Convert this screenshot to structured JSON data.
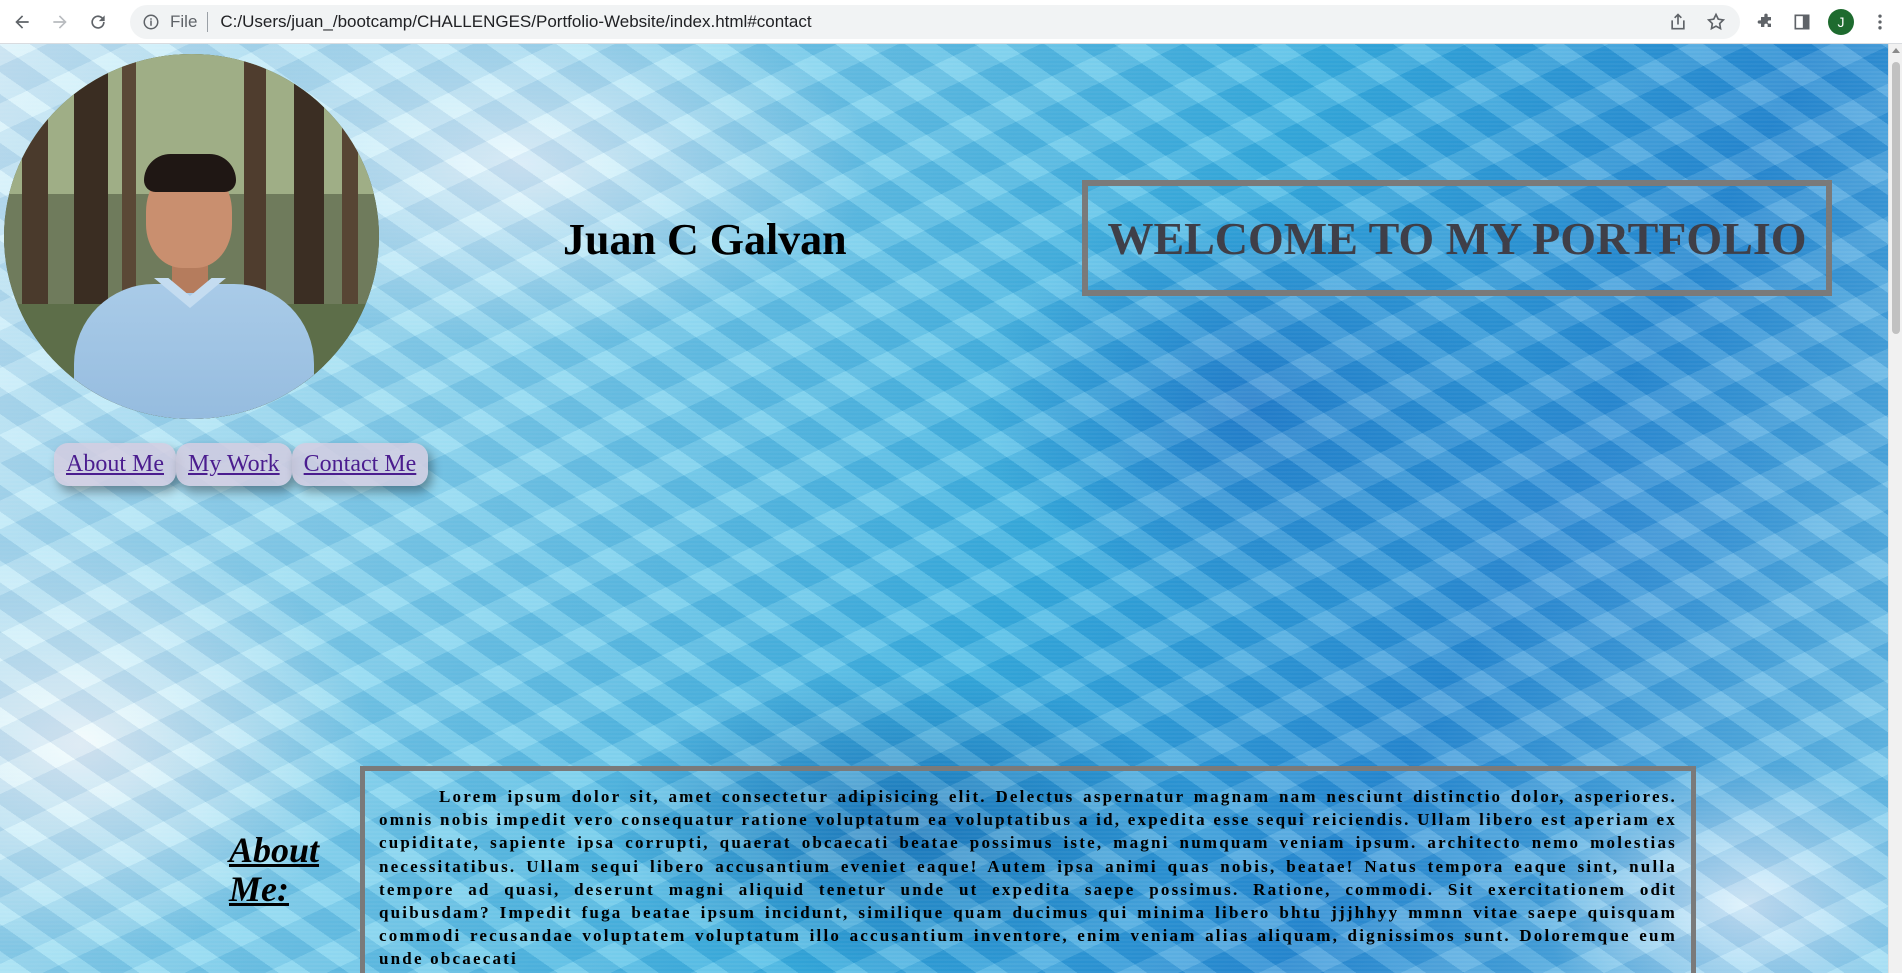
{
  "browser": {
    "scheme_label": "File",
    "url": "C:/Users/juan_/bootcamp/CHALLENGES/Portfolio-Website/index.html#contact",
    "profile_initial": "J"
  },
  "page": {
    "name": "Juan C Galvan",
    "welcome": "WELCOME TO MY PORTFOLIO",
    "nav": [
      {
        "label": "About Me"
      },
      {
        "label": "My Work"
      },
      {
        "label": "Contact Me"
      }
    ],
    "about_heading": "About Me:",
    "about_text": "Lorem ipsum dolor sit, amet consectetur adipisicing elit. Delectus aspernatur magnam nam nesciunt distinctio dolor, asperiores. omnis nobis impedit vero consequatur ratione voluptatum ea voluptatibus a id, expedita esse sequi reiciendis. Ullam libero est aperiam ex cupiditate, sapiente ipsa corrupti, quaerat obcaecati beatae possimus iste, magni numquam veniam ipsum. architecto nemo molestias necessitatibus. Ullam sequi libero accusantium eveniet eaque! Autem ipsa animi quas nobis, beatae! Natus tempora eaque sint, nulla tempore ad quasi, deserunt magni aliquid tenetur unde ut expedita saepe possimus. Ratione, commodi. Sit exercitationem odit quibusdam? Impedit fuga beatae ipsum incidunt, similique quam ducimus qui minima libero bhtu jjjhhyy mmnn vitae saepe quisquam commodi recusandae voluptatem voluptatum illo accusantium inventore, enim veniam alias aliquam, dignissimos sunt. Doloremque eum unde obcaecati"
  },
  "colors": {
    "link": "#4b1d8f",
    "welcome_text": "#3f3f48",
    "box_border": "#7a7a7a",
    "nav_bg": "#d4cde0"
  }
}
